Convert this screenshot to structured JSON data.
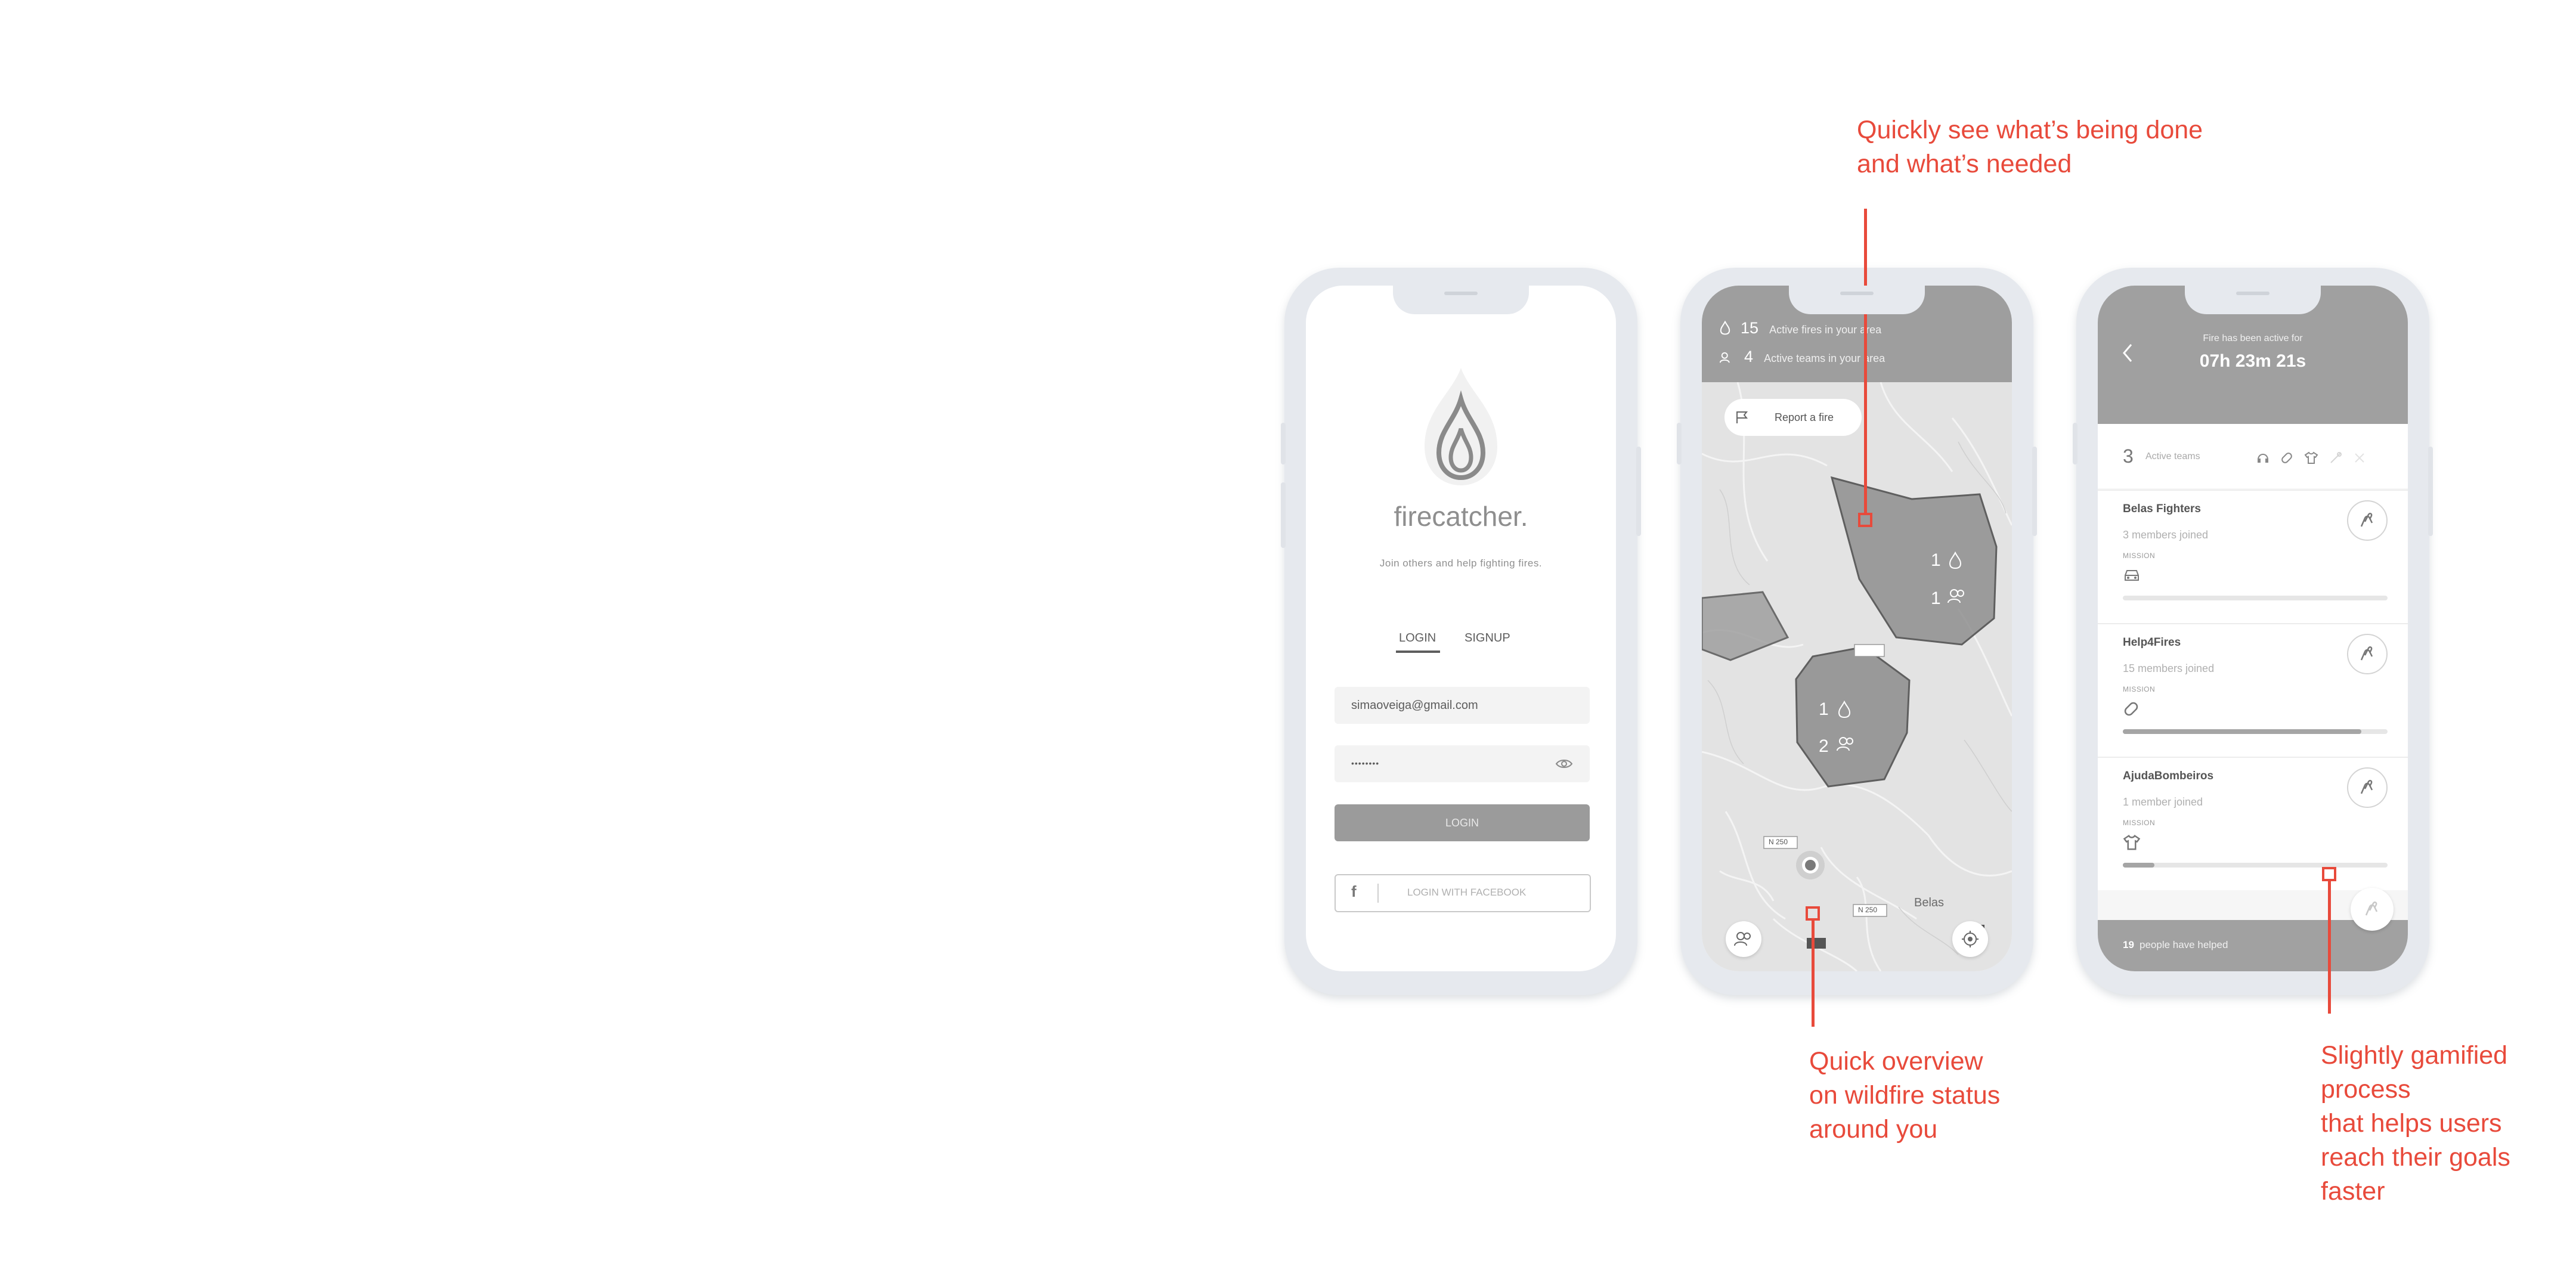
{
  "login_screen": {
    "brand": "firecatcher.",
    "tagline": "Join others and help fighting fires.",
    "tabs": [
      "LOGIN",
      "SIGNUP"
    ],
    "email_value": "simaoveiga@gmail.com",
    "password_value": "••••••••",
    "login_button": "LOGIN",
    "facebook_icon": "f",
    "facebook_button": "LOGIN WITH FACEBOOK"
  },
  "map_screen": {
    "active_fires_count": "15",
    "active_fires_label": "Active fires in your area",
    "active_teams_count": "4",
    "active_teams_label": "Active teams in your area",
    "report_button": "Report a fire",
    "zone_a_fires": "1",
    "zone_a_teams": "1",
    "zone_b_fires": "1",
    "zone_b_teams": "2",
    "road_labels": [
      "N 250",
      "N 250"
    ],
    "place_label": "Belas",
    "icons": [
      "fire-icon",
      "team-icon",
      "flag-icon",
      "locate-icon"
    ]
  },
  "teams_screen": {
    "active_for_label": "Fire has been active for",
    "timer": "07h 23m 21s",
    "active_teams_count": "3",
    "active_teams_label": "Active teams",
    "teams": [
      {
        "name": "Belas Fighters",
        "members": "3 members joined",
        "mission_label": "MISSION",
        "progress": 0
      },
      {
        "name": "Help4Fires",
        "members": "15 members joined",
        "mission_label": "MISSION",
        "progress": 0.9
      },
      {
        "name": "AjudaBombeiros",
        "members": "1 member joined",
        "mission_label": "MISSION",
        "progress": 0.12
      }
    ],
    "helped_count": "19",
    "helped_label": "people have helped"
  },
  "annotations": {
    "top": [
      "Quickly see what’s being done",
      "and what’s needed"
    ],
    "bottom_left": [
      "Quick overview",
      "on wildfire status",
      "around you"
    ],
    "bottom_right": [
      "Slightly gamified",
      "process",
      "that helps users",
      "reach their goals",
      "faster"
    ]
  },
  "colors": {
    "accent": "#e84a3b",
    "frame": "#e6e9ee",
    "header_gray": "#9e9e9e"
  }
}
